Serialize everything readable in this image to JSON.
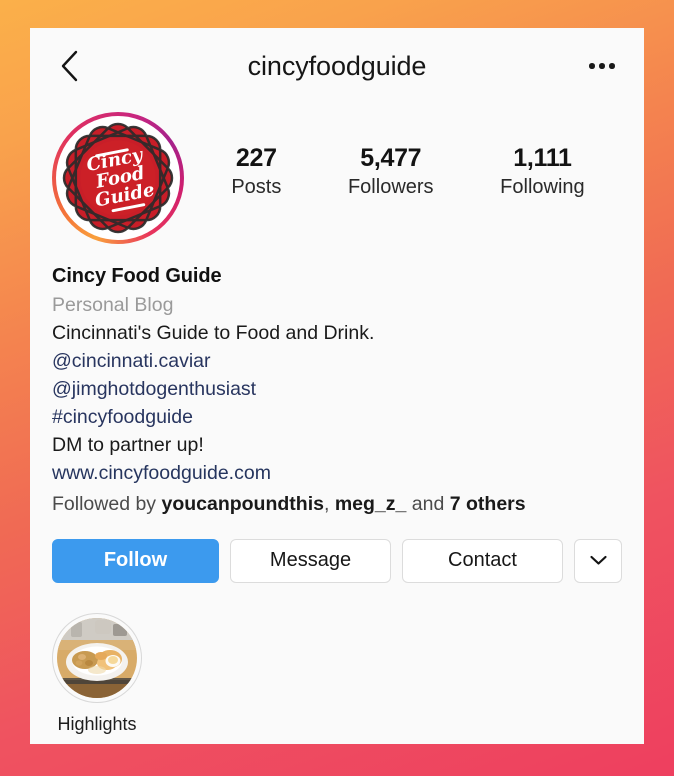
{
  "header": {
    "title": "cincyfoodguide",
    "back_icon": "chevron-left-icon",
    "more_icon": "ellipsis-icon"
  },
  "profile": {
    "avatar_alt": "Cincy Food Guide logo",
    "avatar_logo_lines": [
      "Cincy",
      "Food",
      "Guide"
    ],
    "stats": [
      {
        "value": "227",
        "label": "Posts"
      },
      {
        "value": "5,477",
        "label": "Followers"
      },
      {
        "value": "1,111",
        "label": "Following"
      }
    ],
    "display_name": "Cincy Food Guide",
    "category": "Personal Blog",
    "bio_lines": [
      {
        "text": "Cincinnati's Guide to Food and Drink.",
        "type": "text"
      },
      {
        "text": "@cincinnati.caviar",
        "type": "mention"
      },
      {
        "text": "@jimghotdogenthusiast",
        "type": "mention"
      },
      {
        "text": "#cincyfoodguide",
        "type": "hashtag"
      },
      {
        "text": "DM to partner up!",
        "type": "text"
      }
    ],
    "website": "www.cincyfoodguide.com",
    "followed_by": {
      "prefix": "Followed by ",
      "first_user": "youcanpoundthis",
      "separator": ", ",
      "second_user": "meg_z_",
      "conjunction": " and ",
      "others": "7 others"
    }
  },
  "actions": {
    "follow_label": "Follow",
    "message_label": "Message",
    "contact_label": "Contact",
    "caret_icon": "chevron-down-icon"
  },
  "highlights": [
    {
      "label": "Highlights",
      "thumb_alt": "breakfast plate photo"
    }
  ],
  "colors": {
    "follow_button": "#3c9aee",
    "link_text": "#28355f",
    "category_text": "#9a9a9a",
    "background_start": "#fbb04a",
    "background_end": "#ee3f5f",
    "card_background": "#fafafa"
  }
}
